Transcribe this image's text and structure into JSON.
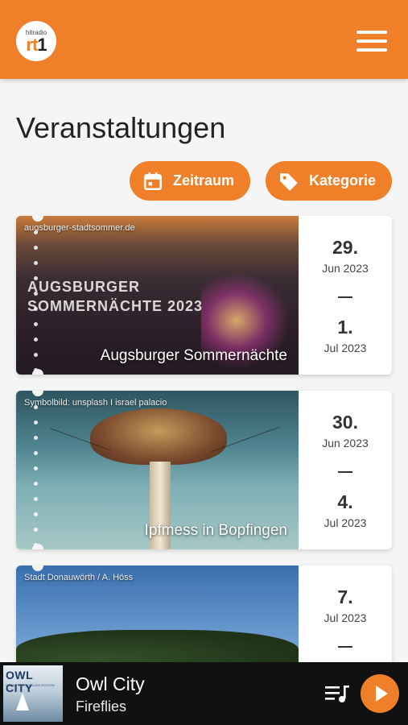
{
  "logo": {
    "small": "hitradio",
    "big_a": "rt",
    "big_b": "1"
  },
  "page": {
    "title": "Veranstaltungen"
  },
  "filters": {
    "zeitraum": "Zeitraum",
    "kategorie": "Kategorie"
  },
  "events": [
    {
      "credit": "augsburger-stadtsommer.de",
      "image_text": "AUGSBURGER\nSOMMERNÄCHTE 2023",
      "title": "Augsburger Sommernächte",
      "start_day": "29.",
      "start_month": "Jun 2023",
      "end_day": "1.",
      "end_month": "Jul 2023"
    },
    {
      "credit": "Symbolbild: unsplash I israel palacio",
      "title": "Ipfmess in Bopfingen",
      "start_day": "30.",
      "start_month": "Jun 2023",
      "end_day": "4.",
      "end_month": "Jul 2023"
    },
    {
      "credit": "Stadt Donauwörth / A. Höss",
      "title": "",
      "start_day": "7.",
      "start_month": "Jul 2023"
    }
  ],
  "player": {
    "album_title": "OWL CITY",
    "album_sub": "OCEAN EYES DELUXE EDITION",
    "track": "Owl City",
    "artist": "Fireflies"
  },
  "colors": {
    "accent": "#f07f2a",
    "player_bg": "#111111"
  },
  "icons": [
    "calendar-icon",
    "tag-icon",
    "menu-icon",
    "queue-music-icon",
    "play-icon"
  ]
}
